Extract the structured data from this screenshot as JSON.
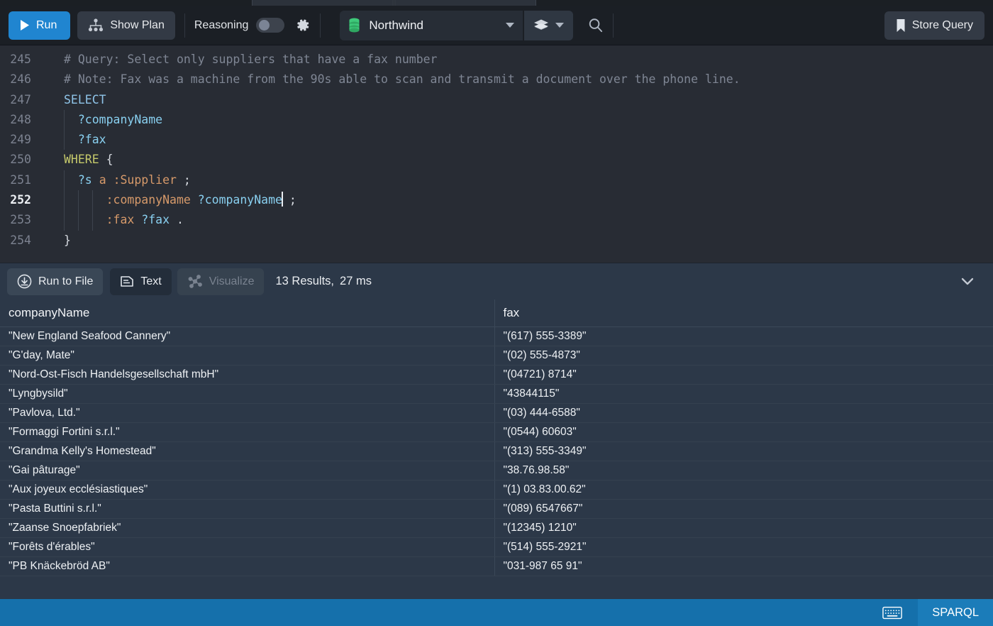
{
  "toolbar": {
    "run_label": "Run",
    "show_plan_label": "Show Plan",
    "reasoning_label": "Reasoning",
    "reasoning_toggle_state": "off",
    "gear_icon": "gear-icon",
    "database_name": "Northwind",
    "database_icon": "database-icon",
    "layers_icon": "layers-icon",
    "search_icon": "search-icon",
    "store_query_label": "Store Query",
    "bookmark_icon": "bookmark-icon",
    "accent_color": "#2085d0"
  },
  "editor": {
    "language": "SPARQL",
    "cursor_line": 252,
    "lines": [
      {
        "num": "245",
        "type": "comment",
        "text": "# Query: Select only suppliers that have a fax number"
      },
      {
        "num": "246",
        "type": "comment",
        "text": "# Note: Fax was a machine from the 90s able to scan and transmit a document over the phone line."
      },
      {
        "num": "247",
        "type": "code",
        "text": "SELECT"
      },
      {
        "num": "248",
        "type": "code",
        "text": "  ?companyName"
      },
      {
        "num": "249",
        "type": "code",
        "text": "  ?fax"
      },
      {
        "num": "250",
        "type": "code",
        "text": "WHERE {"
      },
      {
        "num": "251",
        "type": "code",
        "text": "  ?s a :Supplier ;"
      },
      {
        "num": "252",
        "type": "code",
        "text": "      :companyName ?companyName ;"
      },
      {
        "num": "253",
        "type": "code",
        "text": "      :fax ?fax ."
      },
      {
        "num": "254",
        "type": "code",
        "text": "}"
      }
    ]
  },
  "results_toolbar": {
    "run_to_file_label": "Run to File",
    "run_to_file_icon": "download-circle-icon",
    "text_label": "Text",
    "text_icon": "document-icon",
    "visualize_label": "Visualize",
    "visualize_icon": "graph-nodes-icon",
    "visualize_disabled": true,
    "result_count_text": "13 Results,",
    "duration_text": "27 ms",
    "collapse_icon": "chevron-down-icon"
  },
  "results_table": {
    "columns": [
      "companyName",
      "fax"
    ],
    "rows": [
      [
        "\"New England Seafood Cannery\"",
        "\"(617) 555-3389\""
      ],
      [
        "\"G'day, Mate\"",
        "\"(02) 555-4873\""
      ],
      [
        "\"Nord-Ost-Fisch Handelsgesellschaft mbH\"",
        "\"(04721) 8714\""
      ],
      [
        "\"Lyngbysild\"",
        "\"43844115\""
      ],
      [
        "\"Pavlova, Ltd.\"",
        "\"(03) 444-6588\""
      ],
      [
        "\"Formaggi Fortini s.r.l.\"",
        "\"(0544) 60603\""
      ],
      [
        "\"Grandma Kelly's Homestead\"",
        "\"(313) 555-3349\""
      ],
      [
        "\"Gai pâturage\"",
        "\"38.76.98.58\""
      ],
      [
        "\"Aux joyeux ecclésiastiques\"",
        "\"(1) 03.83.00.62\""
      ],
      [
        "\"Pasta Buttini s.r.l.\"",
        "\"(089) 6547667\""
      ],
      [
        "\"Zaanse Snoepfabriek\"",
        "\"(12345) 1210\""
      ],
      [
        "\"Forêts d'érables\"",
        "\"(514) 555-2921\""
      ],
      [
        "\"PB Knäckebröd AB\"",
        "\"031-987 65 91\""
      ]
    ]
  },
  "statusbar": {
    "keyboard_icon": "keyboard-icon",
    "language_label": "SPARQL",
    "background_color": "#1570ab"
  }
}
